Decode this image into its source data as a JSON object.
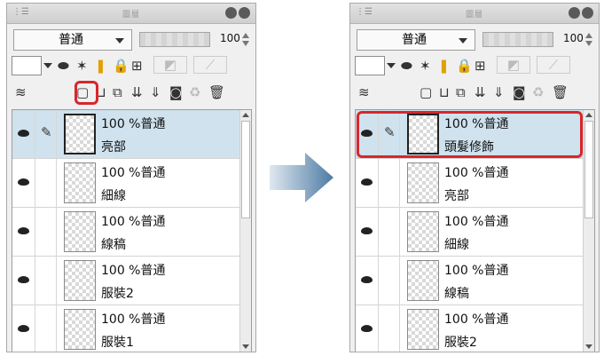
{
  "panels": [
    {
      "title": "圖層",
      "blend_mode": "普通",
      "opacity": "100",
      "layers": [
        {
          "opacity_mode": "100 %普通",
          "name": "亮部",
          "selected": true
        },
        {
          "opacity_mode": "100 %普通",
          "name": "細線",
          "selected": false
        },
        {
          "opacity_mode": "100 %普通",
          "name": "線稿",
          "selected": false
        },
        {
          "opacity_mode": "100 %普通",
          "name": "服裝2",
          "selected": false
        },
        {
          "opacity_mode": "100 %普通",
          "name": "服裝1",
          "selected": false
        }
      ]
    },
    {
      "title": "圖層",
      "blend_mode": "普通",
      "opacity": "100",
      "layers": [
        {
          "opacity_mode": "100 %普通",
          "name": "頭髮修飾",
          "selected": true
        },
        {
          "opacity_mode": "100 %普通",
          "name": "亮部",
          "selected": false
        },
        {
          "opacity_mode": "100 %普通",
          "name": "細線",
          "selected": false
        },
        {
          "opacity_mode": "100 %普通",
          "name": "線稿",
          "selected": false
        },
        {
          "opacity_mode": "100 %普通",
          "name": "服裝2",
          "selected": false
        }
      ]
    }
  ],
  "colors": {
    "highlight": "#d8262c",
    "selection": "#cfe2ee",
    "arrow": "#5b84a8"
  },
  "icons": {
    "new_raster_layer": "new-raster-layer-icon",
    "layers_menu": "layers-menu-icon",
    "delete": "trash-icon"
  }
}
